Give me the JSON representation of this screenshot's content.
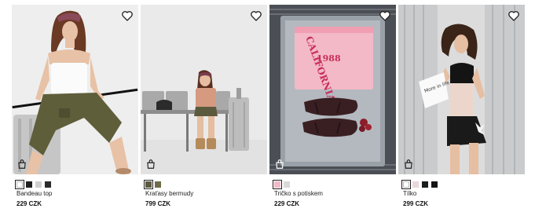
{
  "products": [
    {
      "name": "Bandeau top",
      "price": "229 CZK",
      "swatches": [
        "#ffffff",
        "#1f1f1f",
        "#cfcfcf",
        "#2a2a2a"
      ],
      "selected_swatch": 0
    },
    {
      "name": "Kraťasy bermudy",
      "price": "799 CZK",
      "swatches": [
        "#5b5a3e",
        "#6f6a4a"
      ],
      "selected_swatch": 0
    },
    {
      "name": "Tričko s potiskem",
      "price": "229 CZK",
      "swatches": [
        "#f3b9c6",
        "#d9d9d9"
      ],
      "selected_swatch": 0
    },
    {
      "name": "Tílko",
      "price": "299 CZK",
      "swatches": [
        "#ffffff",
        "#e9d9d9",
        "#1c1c1c",
        "#141414"
      ],
      "selected_swatch": 0
    }
  ],
  "tshirt_print": {
    "line1": "CALIFORNIA",
    "line2": "1988"
  },
  "book_text": "More in life",
  "icons": {
    "wishlist": "heart-icon",
    "add_to_bag": "shopping-bag-icon"
  },
  "colors": {
    "price_text": "#111111",
    "pink_tee": "#f3b9c6"
  }
}
